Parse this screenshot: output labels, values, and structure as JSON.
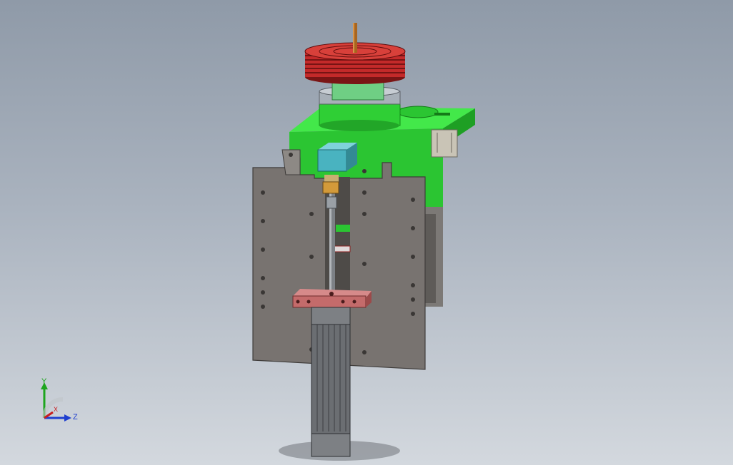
{
  "viewport": {
    "background_top": "#8f9aa8",
    "background_bottom": "#d3d8de"
  },
  "model": {
    "colors": {
      "pulley": "#c42a2a",
      "base_block": "#29d62f",
      "side_plate": "#787370",
      "cylinder": "#6b6e72",
      "sensor_block": "#49b3c0",
      "clamp_block": "#c46b6b",
      "shaft": "#a8651f"
    }
  },
  "triad": {
    "y_axis_label": "Y",
    "z_axis_label": "Z",
    "x_axis_label": "X",
    "y_color": "#1ea51e",
    "z_color": "#1f3fcf",
    "x_color": "#c81e1e"
  }
}
